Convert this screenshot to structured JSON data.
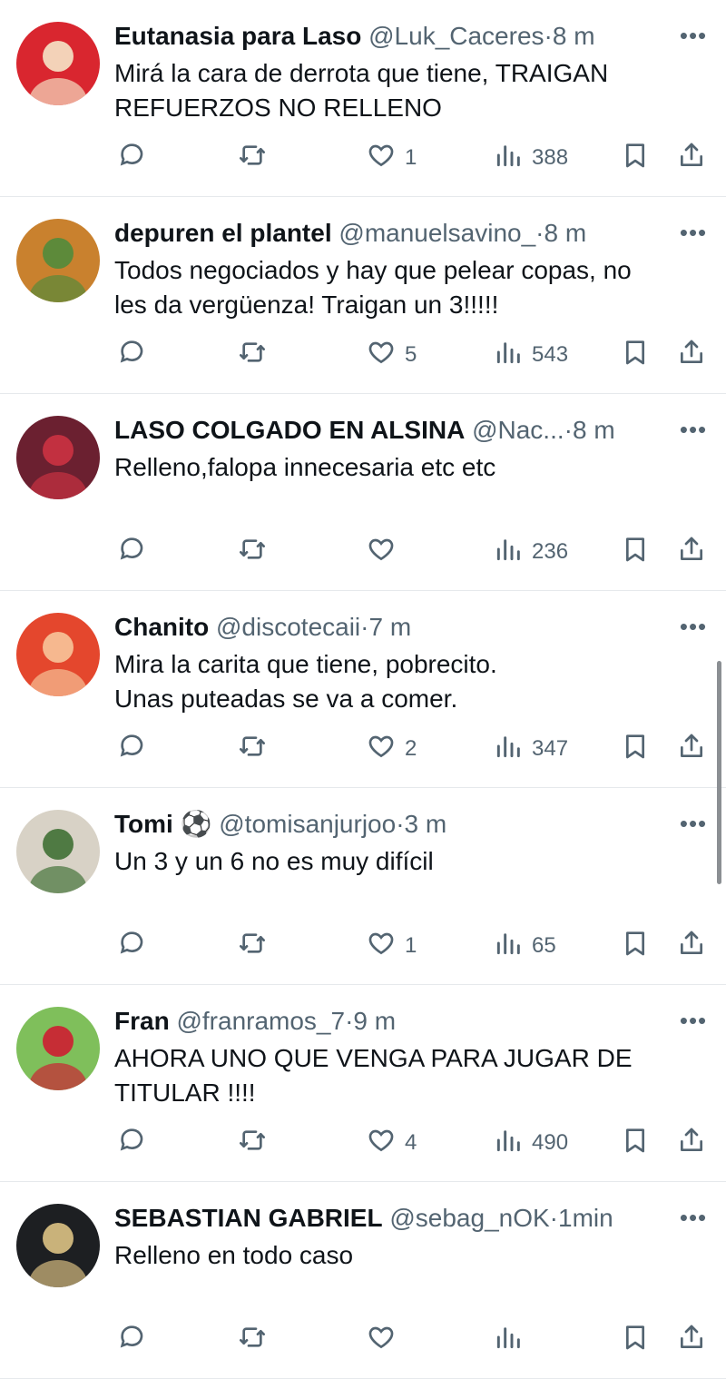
{
  "tweets": [
    {
      "name": "Eutanasia para Laso",
      "emoji": "",
      "handle": "@Luk_Caceres",
      "time": "8 m",
      "text_lines": [
        "Mirá la cara de derrota que tiene, TRAIGAN",
        "REFUERZOS NO RELLENO"
      ],
      "likes": "1",
      "views": "388",
      "avatar_colors": [
        "#d9262f",
        "#f3d2b8"
      ]
    },
    {
      "name": "depuren el plantel",
      "emoji": "",
      "handle": "@manuelsavino_",
      "time": "8 m",
      "text_lines": [
        "Todos negociados y hay que pelear copas, no",
        "les da vergüenza! Traigan un 3!!!!!"
      ],
      "likes": "5",
      "views": "543",
      "avatar_colors": [
        "#c9812e",
        "#5d8a3a"
      ]
    },
    {
      "name": "LASO COLGADO EN ALSINA",
      "emoji": "",
      "handle": "@Nac...",
      "time": "8 m",
      "text_lines": [
        "Relleno,falopa innecesaria etc etc"
      ],
      "likes": "",
      "views": "236",
      "avatar_colors": [
        "#6b2030",
        "#c23040"
      ]
    },
    {
      "name": "Chanito",
      "emoji": "",
      "handle": "@discotecaii",
      "time": "7 m",
      "text_lines": [
        "Mira la carita que tiene, pobrecito.",
        "Unas puteadas se va a comer."
      ],
      "likes": "2",
      "views": "347",
      "avatar_colors": [
        "#e4472d",
        "#f6b88f"
      ]
    },
    {
      "name": "Tomi",
      "emoji": "⚽",
      "handle": "@tomisanjurjoo",
      "time": "3 m",
      "text_lines": [
        "Un 3 y un 6 no es muy difícil"
      ],
      "likes": "1",
      "views": "65",
      "avatar_colors": [
        "#d8d2c6",
        "#4f7a43"
      ]
    },
    {
      "name": "Fran",
      "emoji": "",
      "handle": "@franramos_7",
      "time": "9 m",
      "text_lines": [
        "AHORA UNO QUE VENGA PARA JUGAR DE",
        "TITULAR !!!!"
      ],
      "likes": "4",
      "views": "490",
      "avatar_colors": [
        "#7fbf5b",
        "#c62d35"
      ]
    },
    {
      "name": "SEBASTIAN GABRIEL",
      "emoji": "",
      "handle": "@sebag_nOK",
      "time": "1min",
      "text_lines": [
        "Relleno en todo caso"
      ],
      "likes": "",
      "views": "",
      "avatar_colors": [
        "#1d1f22",
        "#c9b27a"
      ]
    }
  ],
  "separator": "·",
  "icons": {
    "reply": "reply-icon",
    "retweet": "retweet-icon",
    "like": "heart-icon",
    "views": "views-chart-icon",
    "bookmark": "bookmark-icon",
    "share": "share-icon",
    "more": "more-icon"
  },
  "colors": {
    "text": "#0f1419",
    "secondary": "#536471",
    "divider": "#e6e9ec"
  }
}
